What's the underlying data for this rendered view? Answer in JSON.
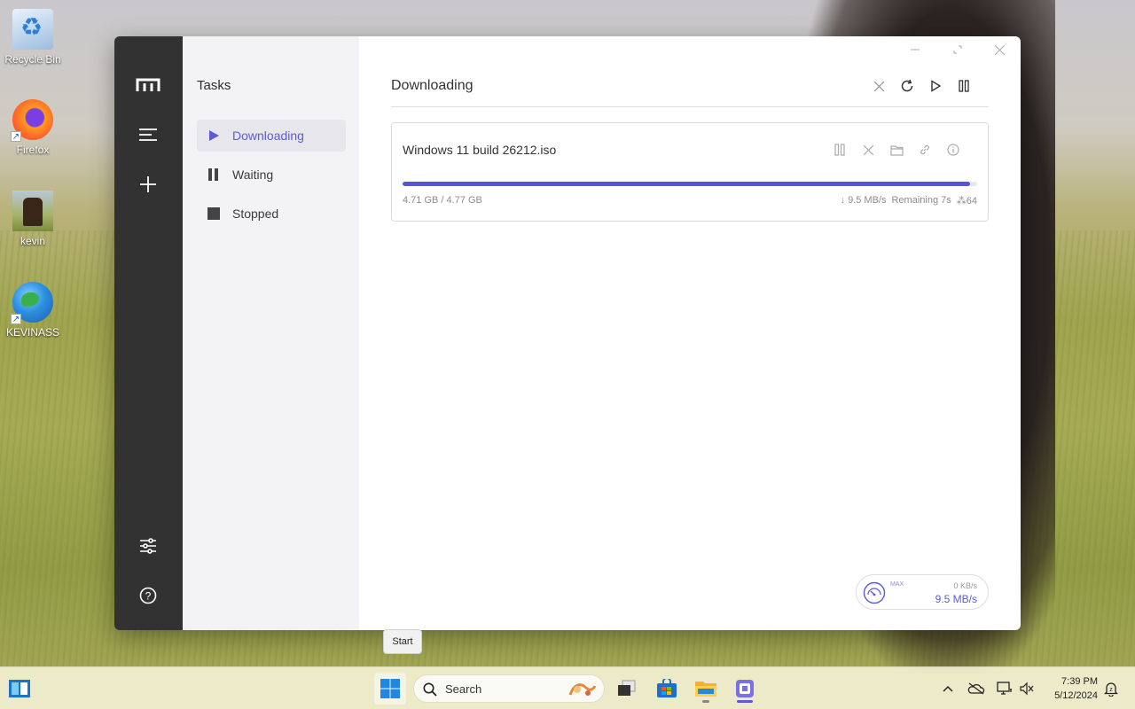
{
  "desktop": {
    "icons": [
      {
        "label": "Recycle Bin",
        "icon": "recycle-bin-icon"
      },
      {
        "label": "Firefox",
        "icon": "firefox-icon"
      },
      {
        "label": "kevin",
        "icon": "image-thumbnail-icon"
      },
      {
        "label": "KEVINASS",
        "icon": "globe-icon"
      }
    ]
  },
  "app": {
    "rail": {
      "logo": "motrix-logo-icon",
      "menu": "menu-icon",
      "add": "plus-icon",
      "settings": "sliders-icon",
      "help": "help-icon"
    },
    "tasks_panel": {
      "title": "Tasks",
      "items": [
        {
          "label": "Downloading",
          "icon": "play-icon",
          "active": true
        },
        {
          "label": "Waiting",
          "icon": "pause-icon",
          "active": false
        },
        {
          "label": "Stopped",
          "icon": "stop-icon",
          "active": false
        }
      ]
    },
    "main": {
      "title": "Downloading",
      "toolbar": [
        "close-icon",
        "refresh-icon",
        "play-icon",
        "pause-icon"
      ],
      "task": {
        "file_name": "Windows 11 build 26212.iso",
        "progress_fraction": 0.988,
        "size": "4.71 GB / 4.77 GB",
        "speed": "↓ 9.5 MB/s",
        "remaining": "Remaining 7s",
        "connections": "⁂64"
      },
      "speedometer": {
        "max_label": "MAX",
        "upload": "0 KB/s",
        "download": "9.5 MB/s"
      }
    }
  },
  "tooltip": {
    "text": "Start"
  },
  "taskbar": {
    "search_placeholder": "Search",
    "clock_time": "7:39 PM",
    "clock_date": "5/12/2024"
  },
  "colors": {
    "accent": "#5b5bd6",
    "rail": "#323233",
    "panel": "#f3f3f5"
  }
}
